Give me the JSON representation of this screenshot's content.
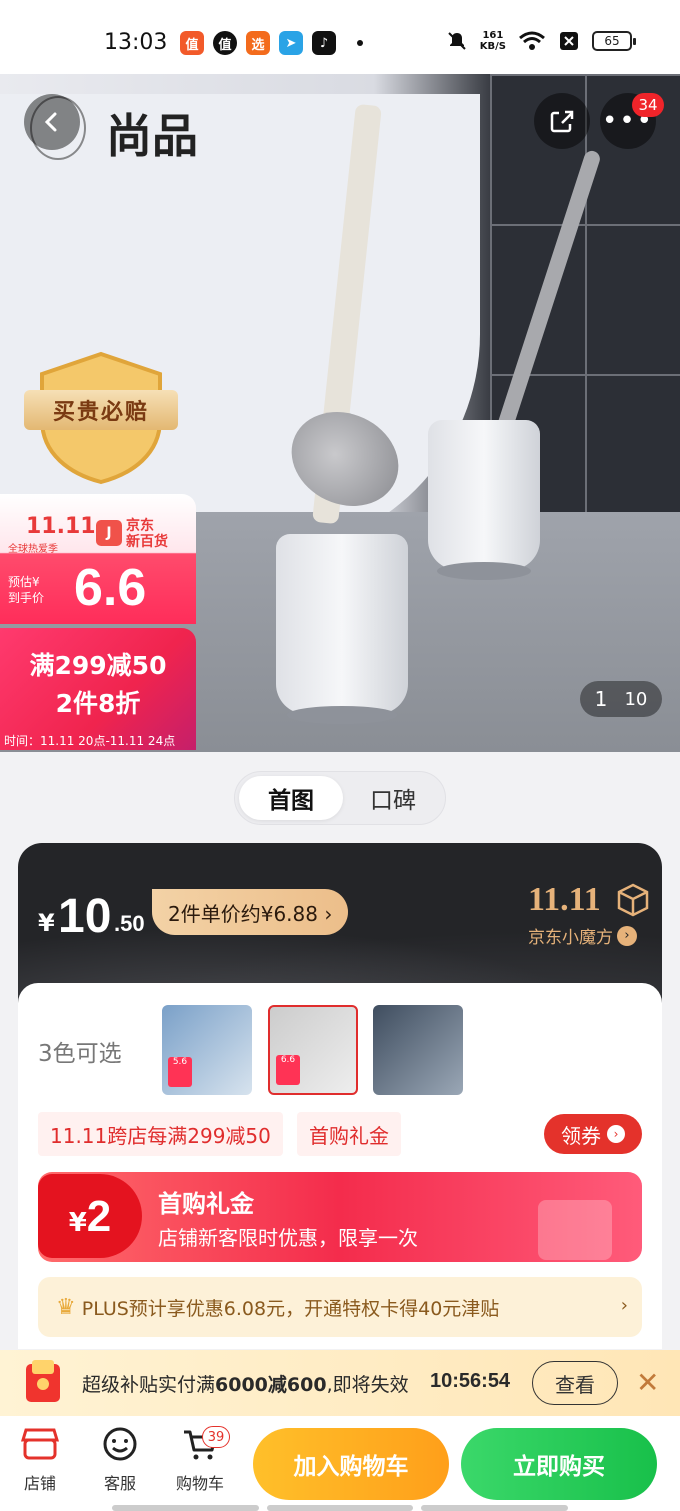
{
  "status_bar": {
    "time": "13:03",
    "speed_value": "161",
    "speed_unit": "KB/S",
    "battery": "65",
    "app_icons": [
      "smzdm-app-icon",
      "zhi-app-icon",
      "mall-app-icon",
      "telegram-app-icon",
      "tiktok-app-icon"
    ]
  },
  "hero": {
    "brand_name": "尚品",
    "guarantee_badge": "买贵必赔",
    "more_badge_count": "34",
    "promo_card": {
      "event_logo": "11.11",
      "event_sub": "全球热爱季",
      "jd_logo": "J",
      "jd_text": "京东\n新百货",
      "price_label": "预估¥\n到手价",
      "price": "6.6"
    },
    "promo_offer": {
      "line1": "满299减50",
      "line2": "2件8折",
      "time": "时间：11.11 20点-11.11 24点"
    },
    "image_counter": {
      "current": "1",
      "total": "10"
    }
  },
  "tabs": [
    {
      "label": "首图",
      "active": true
    },
    {
      "label": "口碑",
      "active": false
    }
  ],
  "price": {
    "currency": "¥",
    "integer": "10",
    "decimal": ".50",
    "unit_price_pill": "2件单价约¥6.88 ›",
    "event_logo": "11.11",
    "event_sub": "京东小魔方",
    "event_sub_arrow": "›"
  },
  "options": {
    "color_label": "3色可选",
    "thumbnail_price": "5.6",
    "thumbnail_selected_price": "6.6"
  },
  "tags": {
    "tag1": "11.11跨店每满299减50",
    "tag2": "首购礼金",
    "coupon_button": "领券"
  },
  "gift": {
    "currency": "¥",
    "amount": "2",
    "title": "首购礼金",
    "desc": "店铺新客限时优惠，限享一次"
  },
  "plus": {
    "text": "PLUS预计享优惠6.08元，开通特权卡得40元津贴",
    "arrow": "›"
  },
  "subsidy": {
    "prefix": "超级补贴实付满",
    "amount": "6000减600",
    "suffix": ",即将失效",
    "countdown": "10:56:54",
    "button": "查看",
    "close": "✕"
  },
  "bottom_nav": {
    "store": "店铺",
    "service": "客服",
    "cart": "购物车",
    "cart_count": "39",
    "add_to_cart": "加入购物车",
    "buy_now": "立即购买"
  },
  "colors": {
    "accent_red": "#e4322b",
    "cart_orange": "#ffa81f",
    "buy_green": "#22c652",
    "gold": "#e6b27a"
  }
}
